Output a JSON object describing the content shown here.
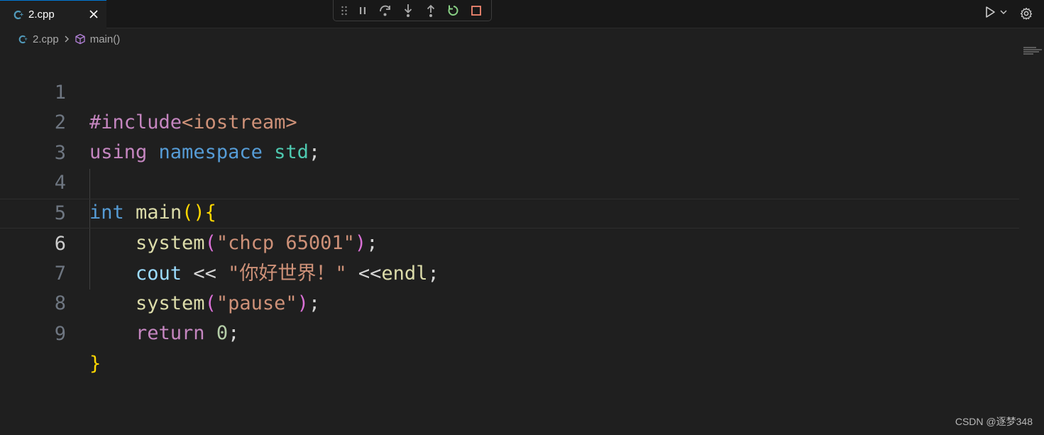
{
  "tab": {
    "label": "2.cpp",
    "file_icon": "cpp-file-icon",
    "close_icon": "close-icon"
  },
  "debug_toolbar": {
    "icons": [
      "drag-grip-icon",
      "pause-icon",
      "step-over-icon",
      "step-into-icon",
      "step-out-icon",
      "restart-icon",
      "stop-icon"
    ],
    "colors": {
      "restart": "#89d185",
      "stop": "#f48771",
      "default": "#a9a9a9"
    }
  },
  "actions": {
    "run_icon": "run-icon",
    "dropdown_icon": "chevron-down-icon",
    "settings_icon": "gear-icon"
  },
  "breadcrumb": {
    "file": "2.cpp",
    "symbol": "main()"
  },
  "editor": {
    "current_line": 6,
    "lines": [
      {
        "n": "1"
      },
      {
        "n": "2"
      },
      {
        "n": "3"
      },
      {
        "n": "4"
      },
      {
        "n": "5"
      },
      {
        "n": "6"
      },
      {
        "n": "7"
      },
      {
        "n": "8"
      },
      {
        "n": "9"
      }
    ],
    "tokens": {
      "l1_pre": "#include",
      "l1_hdr": "<iostream>",
      "l2_using": "using",
      "l2_namespace": "namespace",
      "l2_std": "std",
      "l2_semi": ";",
      "l4_int": "int",
      "l4_main": "main",
      "l4_paren": "()",
      "l4_brace": "{",
      "l5_system": "system",
      "l5_open": "(",
      "l5_str": "\"chcp 65001\"",
      "l5_close": ")",
      "l5_semi": ";",
      "l6_cout": "cout",
      "l6_op": "<<",
      "l6_str_q1": "\"",
      "l6_str_text": "你好世界！",
      "l6_str_q2": "\"",
      "l6_op2": "<<",
      "l6_endl": "endl",
      "l6_semi": ";",
      "l7_system": "system",
      "l7_open": "(",
      "l7_str": "\"pause\"",
      "l7_close": ")",
      "l7_semi": ";",
      "l8_return": "return",
      "l8_num": "0",
      "l8_semi": ";",
      "l9_brace": "}"
    }
  },
  "watermark": "CSDN @逐梦348"
}
